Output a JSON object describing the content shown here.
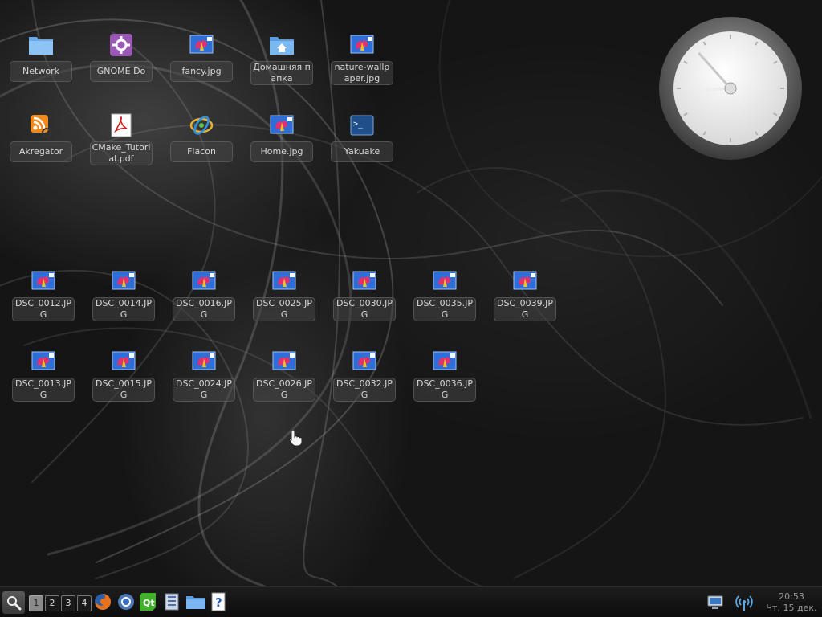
{
  "desktop": {
    "icons": [
      {
        "label": "Network",
        "type": "folder"
      },
      {
        "label": "GNOME Do",
        "type": "gnome-do"
      },
      {
        "label": "fancy.jpg",
        "type": "image"
      },
      {
        "label": "Домашняя папка",
        "type": "home-folder"
      },
      {
        "label": "nature-wallpaper.jpg",
        "type": "image"
      },
      {
        "label": "Akregator",
        "type": "rss"
      },
      {
        "label": "CMake_Tutorial.pdf",
        "type": "pdf"
      },
      {
        "label": "Flacon",
        "type": "flacon"
      },
      {
        "label": "Home.jpg",
        "type": "image"
      },
      {
        "label": "Yakuake",
        "type": "terminal"
      },
      {
        "label": "DSC_0012.JPG",
        "type": "image"
      },
      {
        "label": "DSC_0014.JPG",
        "type": "image"
      },
      {
        "label": "DSC_0016.JPG",
        "type": "image"
      },
      {
        "label": "DSC_0025.JPG",
        "type": "image"
      },
      {
        "label": "DSC_0030.JPG",
        "type": "image"
      },
      {
        "label": "DSC_0035.JPG",
        "type": "image"
      },
      {
        "label": "DSC_0039.JPG",
        "type": "image"
      },
      {
        "label": "DSC_0013.JPG",
        "type": "image"
      },
      {
        "label": "DSC_0015.JPG",
        "type": "image"
      },
      {
        "label": "DSC_0024.JPG",
        "type": "image"
      },
      {
        "label": "DSC_0026.JPG",
        "type": "image"
      },
      {
        "label": "DSC_0032.JPG",
        "type": "image"
      },
      {
        "label": "DSC_0036.JPG",
        "type": "image"
      }
    ]
  },
  "clock_widget": {
    "type": "analog-clock",
    "hour": 20,
    "minute": 53
  },
  "taskbar": {
    "launcher_icon": "search-icon",
    "desktops": [
      "1",
      "2",
      "3",
      "4"
    ],
    "active_desktop": "1",
    "apps": [
      "firefox-icon",
      "chromium-icon",
      "qt-creator-icon",
      "file-manager-icon",
      "folder-icon",
      "help-icon"
    ],
    "tray": [
      "display-icon",
      "wireless-icon"
    ],
    "time": "20:53",
    "date": "Чт, 15 дек."
  },
  "colors": {
    "background": "#151515",
    "label_bg": "#464646",
    "label_text": "#d8d8d8",
    "taskbar": "#141414"
  }
}
